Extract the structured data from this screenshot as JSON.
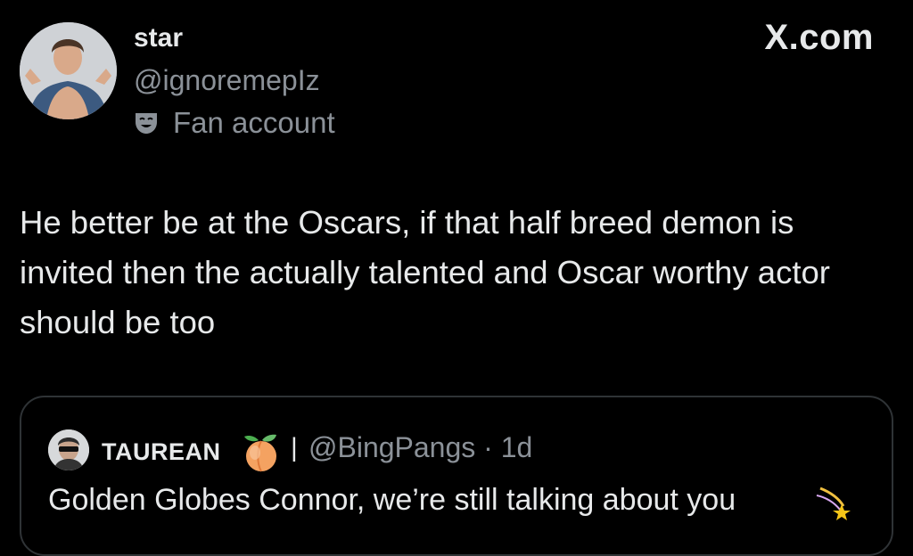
{
  "watermark": {
    "text": "X.com"
  },
  "author": {
    "display_name": "star",
    "handle": "@ignoremepIz",
    "label": "Fan account",
    "label_icon": "theater-mask-icon"
  },
  "tweet": {
    "text": "He better be at the Oscars, if that half breed demon is invited then the actually talented and Oscar worthy actor should be too"
  },
  "quoted_tweet": {
    "author_name": "TAUREAN",
    "name_emoji": "peach-icon",
    "separator": "|",
    "handle_time": "@BingPangs · 1d",
    "text": "Golden Globes Connor, we’re still talking about you",
    "trailing_emoji": "shooting-star-icon"
  },
  "colors": {
    "background": "#000000",
    "primary_text": "#e7e9ea",
    "secondary_text": "#8b9198",
    "border": "#2f3336"
  }
}
